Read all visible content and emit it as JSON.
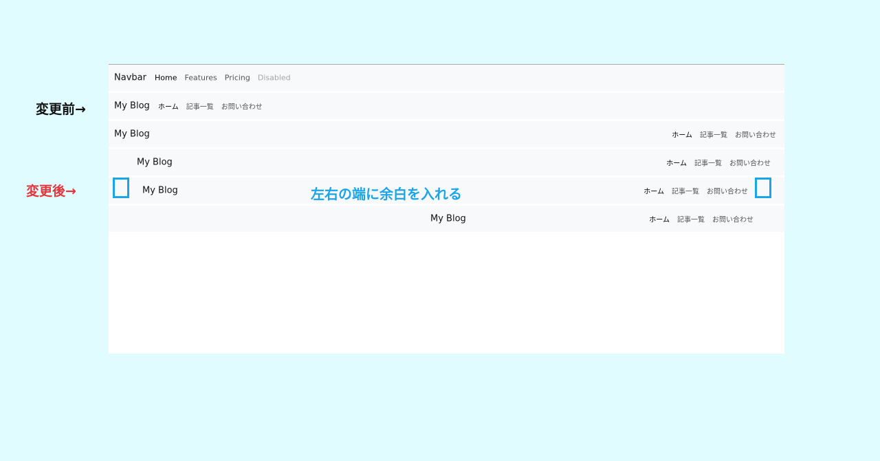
{
  "annotations": {
    "before": "変更前→",
    "after": "変更後→",
    "margin_note": "左右の端に余白を入れる"
  },
  "colors": {
    "page_background": "#e0fcfe",
    "navbar_background": "#f8f9fa",
    "annotation_after": "#e3343b",
    "annotation_margin": "#1aa5e8"
  },
  "navbar_demo": {
    "brand": "Navbar",
    "links": [
      "Home",
      "Features",
      "Pricing",
      "Disabled"
    ]
  },
  "blog": {
    "brand": "My Blog",
    "links": [
      "ホーム",
      "記事一覧",
      "お問い合わせ"
    ]
  }
}
